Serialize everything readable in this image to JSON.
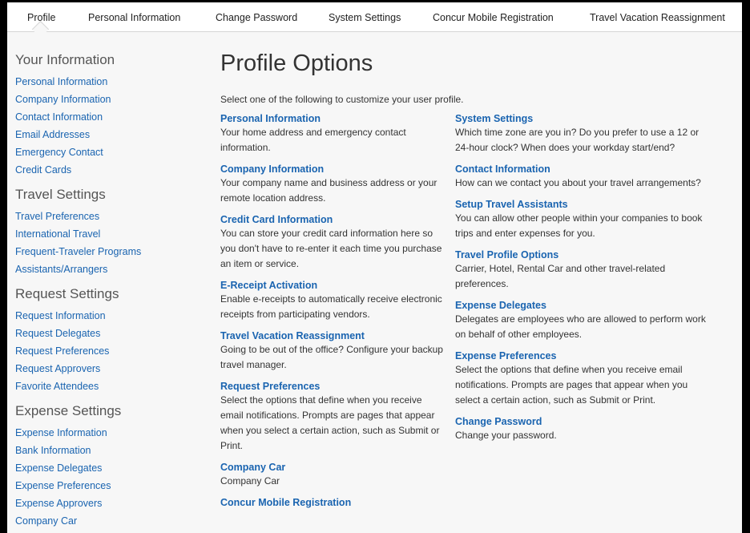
{
  "topnav": {
    "tabs": [
      "Profile",
      "Personal Information",
      "Change Password",
      "System Settings",
      "Concur Mobile Registration",
      "Travel Vacation Reassignment"
    ]
  },
  "sidebar": {
    "groups": [
      {
        "heading": "Your Information",
        "links": [
          "Personal Information",
          "Company Information",
          "Contact Information",
          "Email Addresses",
          "Emergency Contact",
          "Credit Cards"
        ]
      },
      {
        "heading": "Travel Settings",
        "links": [
          "Travel Preferences",
          "International Travel",
          "Frequent-Traveler Programs",
          "Assistants/Arrangers"
        ]
      },
      {
        "heading": "Request Settings",
        "links": [
          "Request Information",
          "Request Delegates",
          "Request Preferences",
          "Request Approvers",
          "Favorite Attendees"
        ]
      },
      {
        "heading": "Expense Settings",
        "links": [
          "Expense Information",
          "Bank Information",
          "Expense Delegates",
          "Expense Preferences",
          "Expense Approvers",
          "Company Car"
        ]
      }
    ]
  },
  "main": {
    "title": "Profile Options",
    "intro": "Select one of the following to customize your user profile.",
    "left": [
      {
        "title": "Personal Information",
        "desc": "Your home address and emergency contact information."
      },
      {
        "title": "Company Information",
        "desc": "Your company name and business address or your remote location address."
      },
      {
        "title": "Credit Card Information",
        "desc": "You can store your credit card information here so you don't have to re-enter it each time you purchase an item or service."
      },
      {
        "title": "E-Receipt Activation",
        "desc": "Enable e-receipts to automatically receive electronic receipts from participating vendors."
      },
      {
        "title": "Travel Vacation Reassignment",
        "desc": "Going to be out of the office? Configure your backup travel manager."
      },
      {
        "title": "Request Preferences",
        "desc": "Select the options that define when you receive email notifications. Prompts are pages that appear when you select a certain action, such as Submit or Print."
      },
      {
        "title": "Company Car",
        "desc": "Company Car"
      },
      {
        "title": "Concur Mobile Registration",
        "desc": ""
      }
    ],
    "right": [
      {
        "title": "System Settings",
        "desc": "Which time zone are you in? Do you prefer to use a 12 or 24-hour clock? When does your workday start/end?"
      },
      {
        "title": "Contact Information",
        "desc": "How can we contact you about your travel arrangements?"
      },
      {
        "title": "Setup Travel Assistants",
        "desc": "You can allow other people within your companies to book trips and enter expenses for you."
      },
      {
        "title": "Travel Profile Options",
        "desc": "Carrier, Hotel, Rental Car and other travel-related preferences."
      },
      {
        "title": "Expense Delegates",
        "desc": "Delegates are employees who are allowed to perform work on behalf of other employees."
      },
      {
        "title": "Expense Preferences",
        "desc": "Select the options that define when you receive email notifications. Prompts are pages that appear when you select a certain action, such as Submit or Print."
      },
      {
        "title": "Change Password",
        "desc": "Change your password."
      }
    ]
  }
}
